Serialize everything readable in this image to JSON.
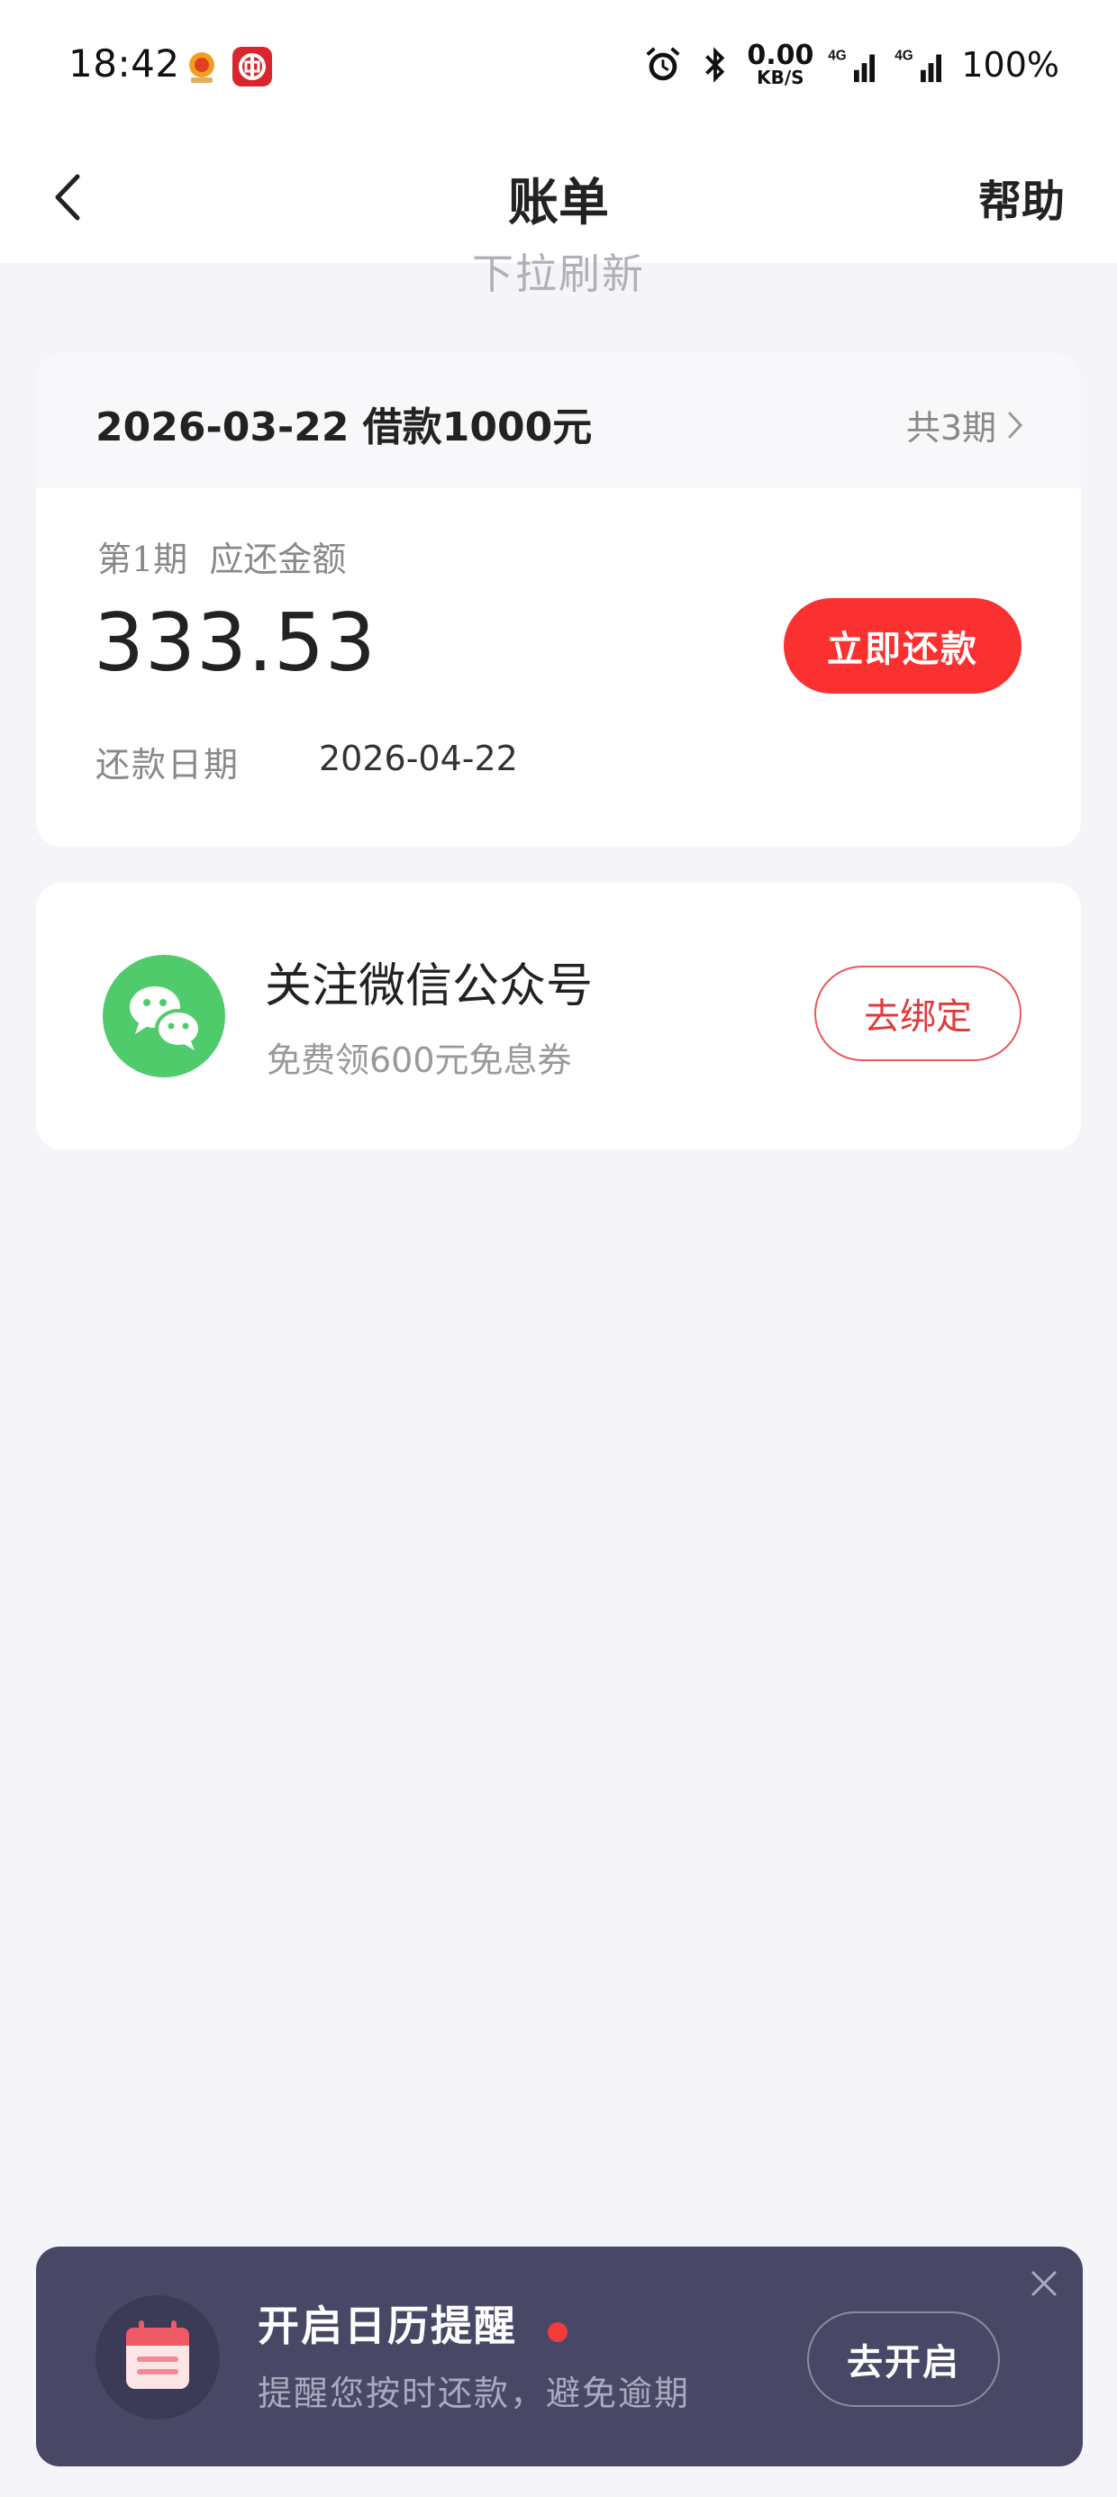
{
  "status_bar": {
    "time": "18:42",
    "network_speed": "0.00",
    "network_unit": "KB/S",
    "signal1": "4G",
    "signal2": "4G",
    "battery": "100%"
  },
  "nav": {
    "title": "账单",
    "help": "帮助"
  },
  "pull_hint": "下拉刷新",
  "bill": {
    "header": "2026-03-22 借款1000元",
    "periods": "共3期",
    "label": "第1期  应还金额",
    "amount": "333.53",
    "pay_button": "立即还款",
    "due_label": "还款日期",
    "due_date": "2026-04-22"
  },
  "wechat": {
    "title": "关注微信公众号",
    "subtitle": "免费领600元免息券",
    "bind_button": "去绑定",
    "brand_color": "#4fcb6b"
  },
  "calendar": {
    "title": "开启日历提醒",
    "subtitle": "提醒您按时还款，避免逾期",
    "button": "去开启"
  },
  "colors": {
    "accent_red": "#fb3031",
    "banner_bg": "#484866",
    "page_bg": "#f4f4f9"
  }
}
